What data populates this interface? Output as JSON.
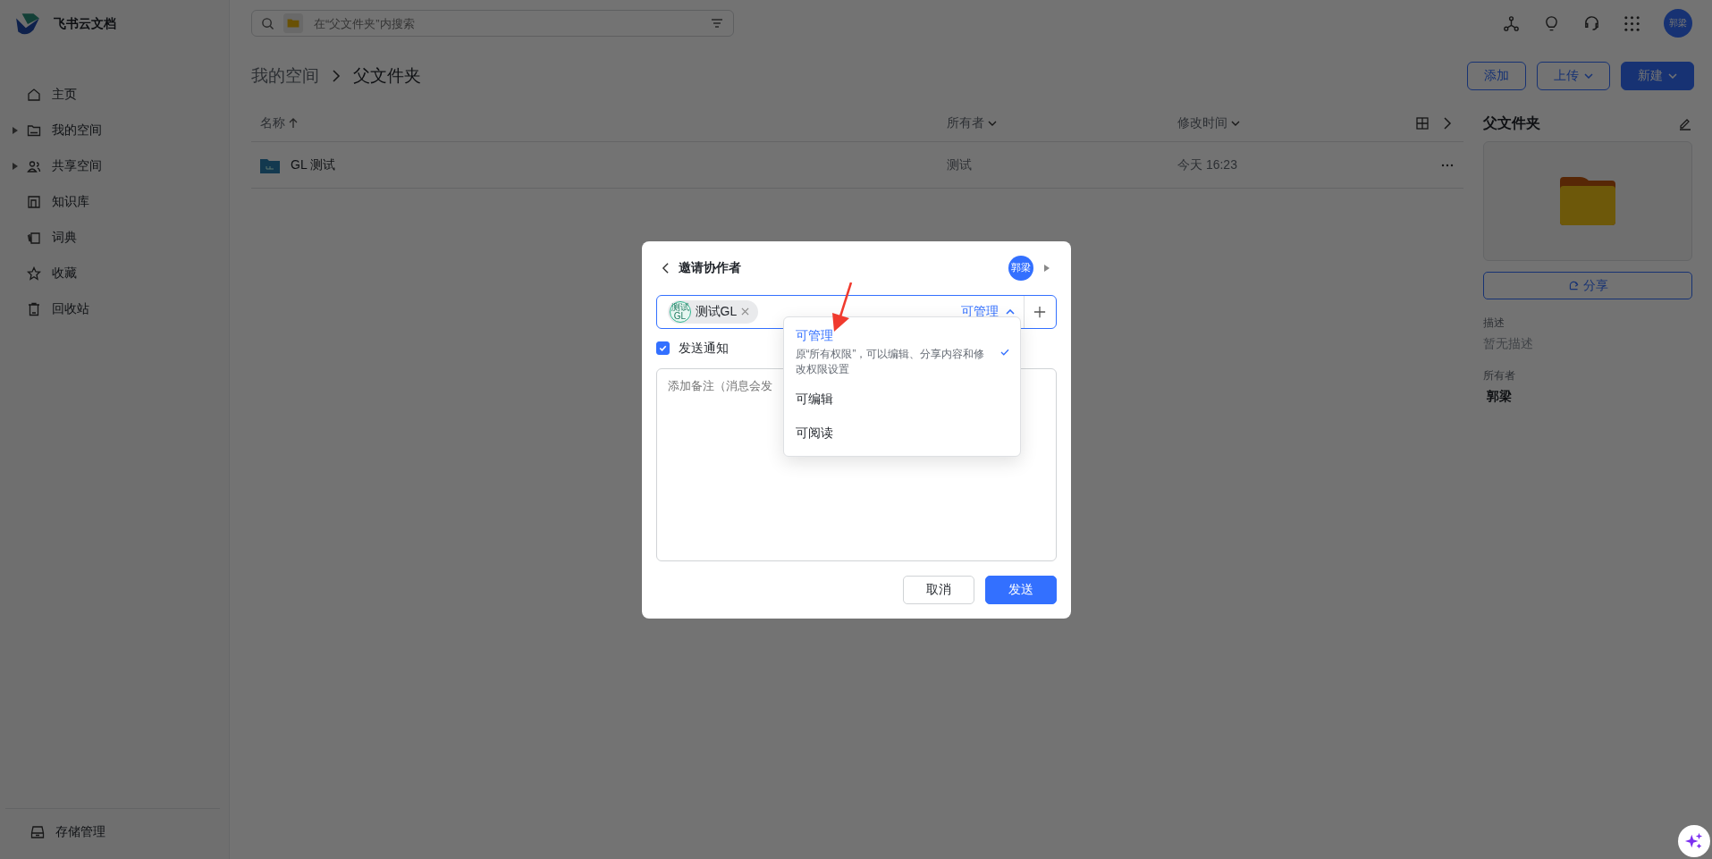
{
  "app": {
    "name": "飞书云文档"
  },
  "sidebar": {
    "items": [
      {
        "label": "主页",
        "kind": "link"
      },
      {
        "label": "我的空间",
        "kind": "group"
      },
      {
        "label": "共享空间",
        "kind": "group"
      },
      {
        "label": "知识库",
        "kind": "link"
      },
      {
        "label": "词典",
        "kind": "link"
      },
      {
        "label": "收藏",
        "kind": "link"
      },
      {
        "label": "回收站",
        "kind": "link"
      }
    ],
    "footer": "存储管理"
  },
  "search": {
    "placeholder": "在“父文件夹”内搜索"
  },
  "user": {
    "avatar": "郭梁"
  },
  "breadcrumb": [
    "我的空间",
    "父文件夹"
  ],
  "actions": [
    {
      "label": "添加",
      "kind": "outline"
    },
    {
      "label": "上传",
      "kind": "outline-menu"
    },
    {
      "label": "新建",
      "kind": "primary-menu"
    }
  ],
  "table": {
    "columns": [
      "名称",
      "所有者",
      "修改时间"
    ],
    "rows": [
      {
        "name": "GL 测试",
        "owner": "测试",
        "modified": "今天 16:23"
      }
    ]
  },
  "details": {
    "title": "父文件夹",
    "share": "分享",
    "description_label": "描述",
    "description": "暂无描述",
    "owner_label": "所有者",
    "owner": "郭梁"
  },
  "dialog": {
    "title": "邀请协作者",
    "avatar": "郭梁",
    "chip": {
      "avatar": "测试GL",
      "label": "测试GL"
    },
    "permission": "可管理",
    "notify": {
      "label": "发送通知",
      "checked": true
    },
    "note": {
      "placeholder": "添加备注（消息会发"
    },
    "options": [
      {
        "label": "可管理",
        "description": "原“所有权限”，可以编辑、分享内容和修改权限设置",
        "selected": true
      },
      {
        "label": "可编辑",
        "selected": false
      },
      {
        "label": "可阅读",
        "selected": false
      }
    ],
    "buttons": [
      {
        "label": "取消",
        "kind": "secondary"
      },
      {
        "label": "发送",
        "kind": "primary"
      }
    ]
  }
}
